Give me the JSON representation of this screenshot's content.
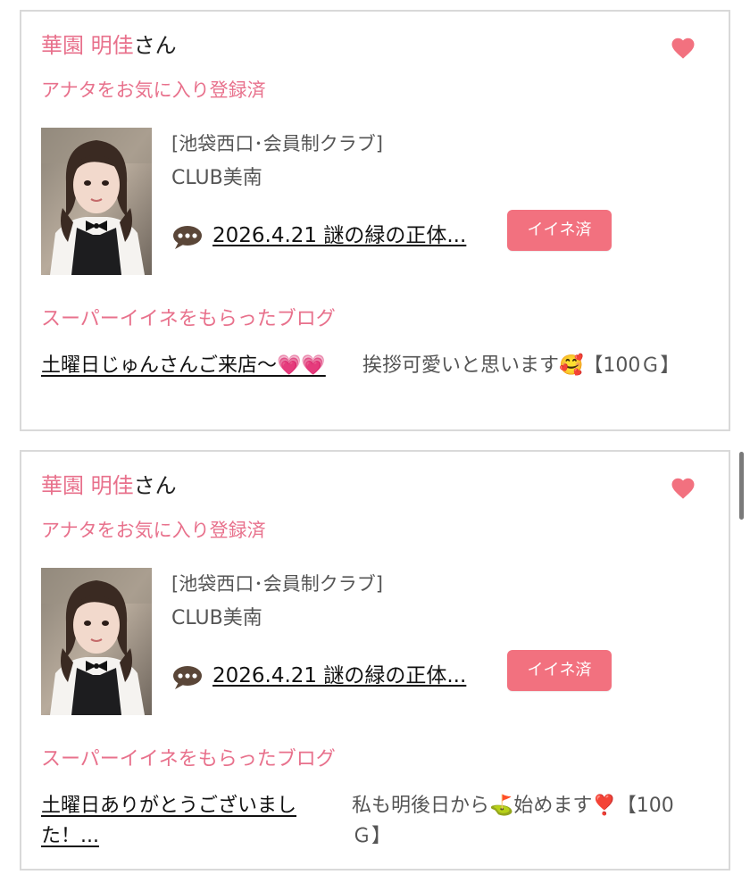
{
  "cards": [
    {
      "user_name": "華園 明佳",
      "user_suffix": "さん",
      "favorite_status": "アナタをお気に入り登録済",
      "shop_area": "[池袋西口･会員制クラブ]",
      "shop_name": "CLUB美南",
      "blog_link": "2026.4.21 謎の緑の正体...",
      "iine_label": "イイネ済",
      "super_heading": "スーパーイイネをもらったブログ",
      "super_blog_title": "土曜日じゅんさんご来店〜💗💗",
      "super_comment": "挨拶可愛いと思います🥰【100Ｇ】"
    },
    {
      "user_name": "華園 明佳",
      "user_suffix": "さん",
      "favorite_status": "アナタをお気に入り登録済",
      "shop_area": "[池袋西口･会員制クラブ]",
      "shop_name": "CLUB美南",
      "blog_link": "2026.4.21 謎の緑の正体...",
      "iine_label": "イイネ済",
      "super_heading": "スーパーイイネをもらったブログ",
      "super_blog_title": "土曜日ありがとうございました！...",
      "super_comment": "私も明後日から⛳始めます❣️【100Ｇ】"
    }
  ],
  "icons": {
    "heart": "heart-icon",
    "comment": "speech-bubble-icon"
  },
  "colors": {
    "accent_pink": "#e8718c",
    "button_pink": "#f2717f",
    "card_border": "#d9d9d9"
  }
}
